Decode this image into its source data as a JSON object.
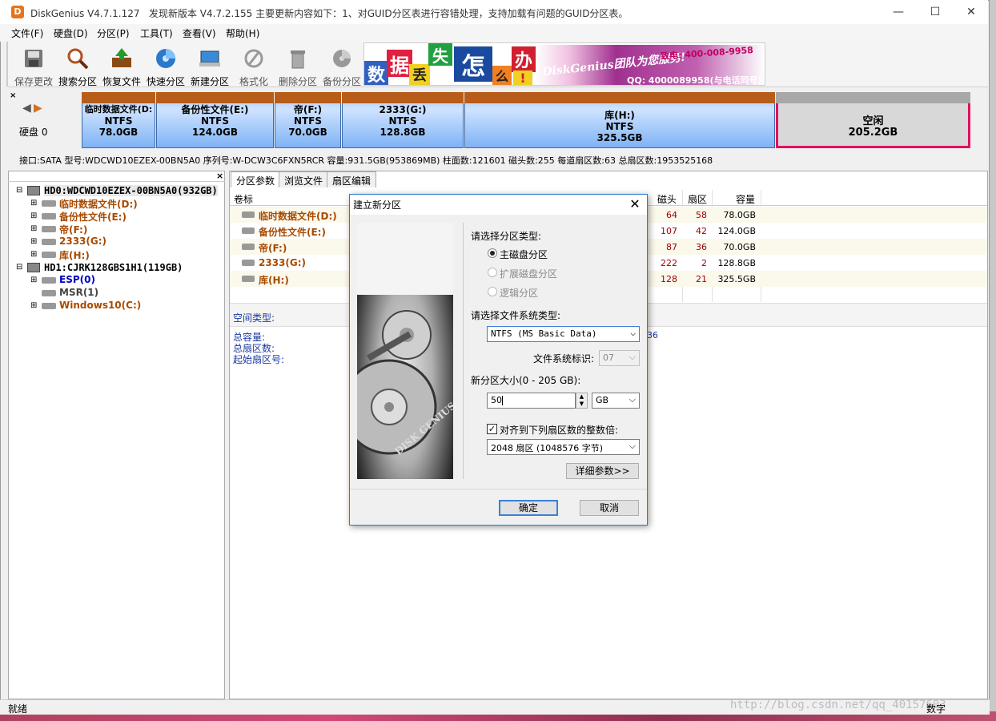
{
  "app": {
    "title": "DiskGenius V4.7.1.127",
    "update_notice": "发现新版本 V4.7.2.155 主要更新内容如下：1、对GUID分区表进行容错处理，支持加载有问题的GUID分区表。",
    "logo_letter": "D"
  },
  "window_controls": {
    "minimize": "—",
    "maximize": "☐",
    "close": "✕"
  },
  "menu": [
    "文件(F)",
    "硬盘(D)",
    "分区(P)",
    "工具(T)",
    "查看(V)",
    "帮助(H)"
  ],
  "toolbar": [
    {
      "label": "保存更改",
      "icon": "save-disk-icon"
    },
    {
      "label": "搜索分区",
      "icon": "magnifier-icon"
    },
    {
      "label": "恢复文件",
      "icon": "restore-box-icon"
    },
    {
      "label": "快速分区",
      "icon": "quick-partition-icon"
    },
    {
      "label": "新建分区",
      "icon": "new-partition-icon"
    },
    {
      "label": "格式化",
      "icon": "format-icon"
    },
    {
      "label": "删除分区",
      "icon": "trash-icon"
    },
    {
      "label": "备份分区",
      "icon": "backup-icon"
    }
  ],
  "banner": {
    "chars": [
      "数",
      "据",
      "丢",
      "失",
      "怎",
      "么",
      "办",
      "!"
    ],
    "slogan": "DiskGenius团队为您服务!",
    "phone": "致电: 400-008-9958",
    "qq": "QQ: 4000089958(与电话同号)"
  },
  "disk_map": {
    "disk_label": "硬盘 0",
    "partitions": [
      {
        "name": "临时数据文件(D:",
        "fs": "NTFS",
        "size": "78.0GB"
      },
      {
        "name": "备份性文件(E:)",
        "fs": "NTFS",
        "size": "124.0GB"
      },
      {
        "name": "帝(F:)",
        "fs": "NTFS",
        "size": "70.0GB"
      },
      {
        "name": "2333(G:)",
        "fs": "NTFS",
        "size": "128.8GB"
      },
      {
        "name": "库(H:)",
        "fs": "NTFS",
        "size": "325.5GB"
      }
    ],
    "free": {
      "name": "空闲",
      "size": "205.2GB"
    }
  },
  "disk_info": "接口:SATA  型号:WDCWD10EZEX-00BN5A0  序列号:W-DCW3C6FXN5RCR  容量:931.5GB(953869MB)  柱面数:121601  磁头数:255  每道扇区数:63  总扇区数:1953525168",
  "tree": {
    "disk0": "HD0:WDCWD10EZEX-00BN5A0(932GB)",
    "disk0_parts": [
      "临时数据文件(D:)",
      "备份性文件(E:)",
      "帝(F:)",
      "2333(G:)",
      "库(H:)"
    ],
    "disk1": "HD1:CJRK128GBS1H1(119GB)",
    "disk1_parts": [
      "ESP(0)",
      "MSR(1)",
      "Windows10(C:)"
    ]
  },
  "tabs": [
    "分区参数",
    "浏览文件",
    "扇区编辑"
  ],
  "table": {
    "headers": [
      "卷标",
      "磁头",
      "扇区",
      "容量"
    ],
    "rows": [
      {
        "label": "临时数据文件(D:)",
        "head": "64",
        "sector": "58",
        "cap": "78.0GB"
      },
      {
        "label": "备份性文件(E:)",
        "head": "107",
        "sector": "42",
        "cap": "124.0GB"
      },
      {
        "label": "帝(F:)",
        "head": "87",
        "sector": "36",
        "cap": "70.0GB"
      },
      {
        "label": "2333(G:)",
        "head": "222",
        "sector": "2",
        "cap": "128.8GB"
      },
      {
        "label": "库(H:)",
        "head": "128",
        "sector": "21",
        "cap": "325.5GB"
      }
    ]
  },
  "details": {
    "space_type": "空间类型:",
    "total_cap": "总容量:",
    "total_sectors": "总扇区数:",
    "start_sector": "起始扇区号:",
    "partial_value": "36"
  },
  "dialog": {
    "title": "建立新分区",
    "close": "✕",
    "type_prompt": "请选择分区类型:",
    "types": [
      {
        "label": "主磁盘分区",
        "selected": true,
        "enabled": true
      },
      {
        "label": "扩展磁盘分区",
        "selected": false,
        "enabled": false
      },
      {
        "label": "逻辑分区",
        "selected": false,
        "enabled": false
      }
    ],
    "fs_prompt": "请选择文件系统类型:",
    "fs_value": "NTFS (MS Basic Data)",
    "fs_id_label": "文件系统标识:",
    "fs_id_value": "07",
    "size_prompt": "新分区大小(0 - 205 GB):",
    "size_value": "50",
    "size_unit": "GB",
    "align_label": "对齐到下列扇区数的整数倍:",
    "align_checked": true,
    "align_value": "2048 扇区 (1048576 字节)",
    "advanced_button": "详细参数>>",
    "ok_button": "确定",
    "cancel_button": "取消",
    "image_text": "DISK GENIUS"
  },
  "status": {
    "text": "就绪",
    "numlock": "数字",
    "watermark": "http://blog.csdn.net/qq_40157603"
  }
}
